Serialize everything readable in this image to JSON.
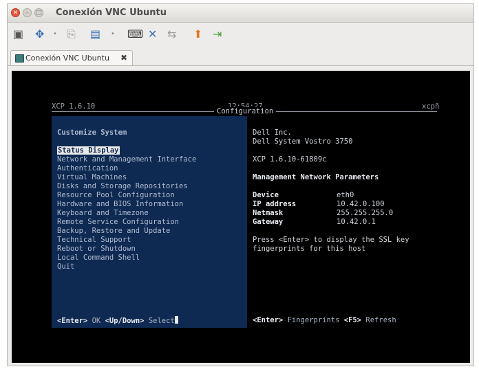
{
  "window": {
    "title": "Conexión VNC Ubuntu",
    "tab_label": "Conexión VNC Ubuntu",
    "tab_close": "✖"
  },
  "toolbar": {
    "icons": [
      "fullscreen-icon",
      "move-icon",
      "dot",
      "copy-icon",
      "view-icon",
      "dot",
      "keyboard-icon",
      "tools-icon",
      "transfer-icon",
      "upload-icon",
      "disconnect-icon"
    ]
  },
  "xcp": {
    "version": "XCP 1.6.10",
    "time": "12:54:27",
    "host": "xcpñ",
    "panel_title": "Configuration",
    "left": {
      "heading": "Customize System",
      "items": [
        "Status Display",
        "Network and Management Interface",
        "Authentication",
        "Virtual Machines",
        "Disks and Storage Repositories",
        "Resource Pool Configuration",
        "Hardware and BIOS Information",
        "Keyboard and Timezone",
        "Remote Service Configuration",
        "Backup, Restore and Update",
        "Technical Support",
        "Reboot or Shutdown",
        "Local Command Shell",
        "Quit"
      ],
      "footer_key1": "<Enter>",
      "footer_text1": "OK",
      "footer_key2": "<Up/Down>",
      "footer_text2": "Select"
    },
    "right": {
      "vendor": "Dell Inc.",
      "model": "Dell System Vostro 3750",
      "build": "XCP 1.6.10-61809c",
      "section": "Management Network Parameters",
      "params": [
        {
          "label": "Device",
          "value": "eth0"
        },
        {
          "label": "IP address",
          "value": "10.42.0.100"
        },
        {
          "label": "Netmask",
          "value": "255.255.255.0"
        },
        {
          "label": "Gateway",
          "value": "10.42.0.1"
        }
      ],
      "note_line1": "Press <Enter> to display the SSL key",
      "note_line2": "fingerprints for this host",
      "footer_key1": "<Enter>",
      "footer_text1": "Fingerprints",
      "footer_key2": "<F5>",
      "footer_text2": "Refresh"
    }
  },
  "colors": {
    "accent": "#e6543a",
    "panel_blue": "#0f2a52",
    "terminal_bg": "#000000"
  }
}
